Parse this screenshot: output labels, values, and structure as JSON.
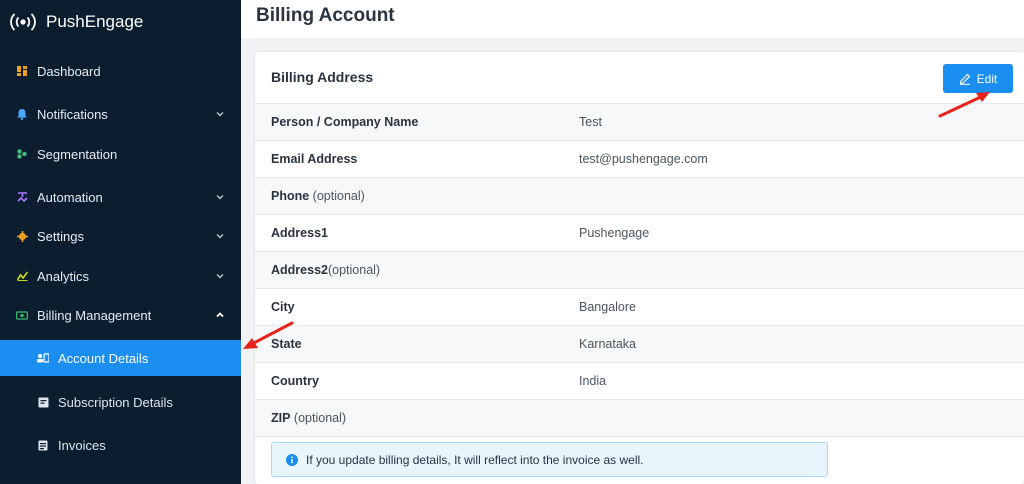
{
  "app": {
    "brand": "PushEngage",
    "page_title": "Billing Account"
  },
  "sidebar": {
    "items": [
      {
        "label": "Dashboard",
        "icon": "dashboard-icon",
        "icon_color": "#f0a020"
      },
      {
        "label": "Notifications",
        "icon": "bell-icon",
        "icon_color": "#4aa8ff",
        "expandable": true
      },
      {
        "label": "Segmentation",
        "icon": "segmentation-icon",
        "icon_color": "#3fbf7f"
      },
      {
        "label": "Automation",
        "icon": "automation-icon",
        "icon_color": "#a97cff",
        "expandable": true
      },
      {
        "label": "Settings",
        "icon": "gear-icon",
        "icon_color": "#f0a020",
        "expandable": true
      },
      {
        "label": "Analytics",
        "icon": "analytics-icon",
        "icon_color": "#c8d81f",
        "expandable": true
      },
      {
        "label": "Billing Management",
        "icon": "billing-icon",
        "icon_color": "#39c36a",
        "expanded": true
      }
    ],
    "sub_items": [
      {
        "label": "Account Details",
        "icon": "account-card-icon",
        "active": true
      },
      {
        "label": "Subscription Details",
        "icon": "subscription-icon",
        "active": false
      },
      {
        "label": "Invoices",
        "icon": "invoice-icon",
        "active": false
      }
    ]
  },
  "billing": {
    "section_title": "Billing Address",
    "edit_label": "Edit",
    "rows": [
      {
        "label": "Person / Company Name",
        "optional": "",
        "value": "Test"
      },
      {
        "label": "Email Address",
        "optional": "",
        "value": "test@pushengage.com"
      },
      {
        "label": "Phone",
        "optional": " (optional)",
        "value": ""
      },
      {
        "label": "Address1",
        "optional": "",
        "value": "Pushengage"
      },
      {
        "label": "Address2",
        "optional": "(optional)",
        "value": ""
      },
      {
        "label": "City",
        "optional": "",
        "value": "Bangalore"
      },
      {
        "label": "State",
        "optional": "",
        "value": "Karnataka"
      },
      {
        "label": "Country",
        "optional": "",
        "value": "India"
      },
      {
        "label": "ZIP",
        "optional": " (optional)",
        "value": ""
      }
    ],
    "info_text": "If you update billing details, It will reflect into the invoice as well."
  },
  "colors": {
    "sidebar_bg": "#0b1d2f",
    "accent": "#1b8ef2",
    "annotation_arrow": "#e8231a"
  }
}
